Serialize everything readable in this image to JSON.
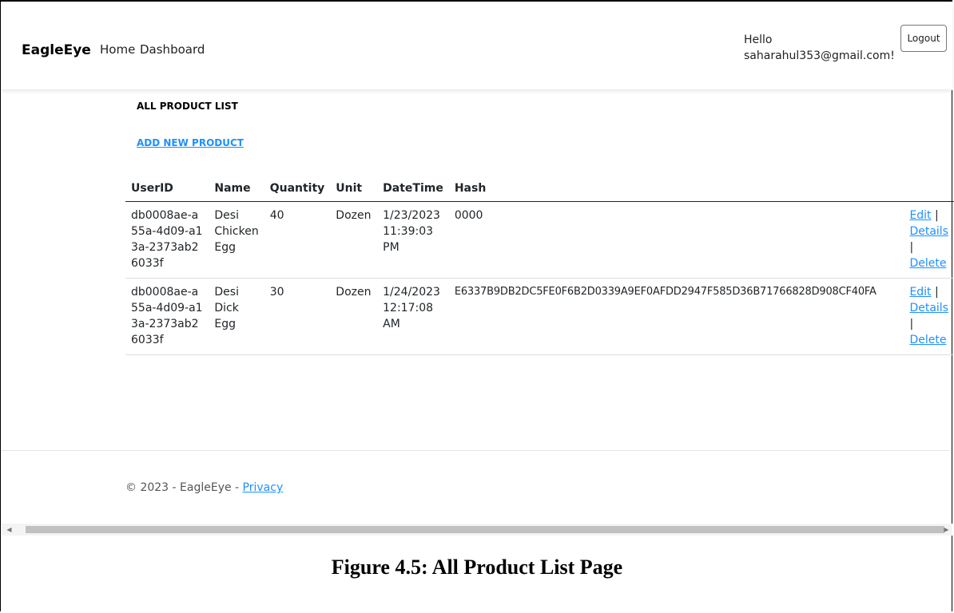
{
  "navbar": {
    "brand": "EagleEye",
    "links": [
      "Home",
      "Dashboard"
    ],
    "greeting_line1": "Hello",
    "greeting_line2": "saharahul353@gmail.com!",
    "logout_label": "Logout"
  },
  "main": {
    "title": "ALL PRODUCT LIST",
    "add_link": "ADD NEW PRODUCT",
    "columns": [
      "UserID",
      "Name",
      "Quantity",
      "Unit",
      "DateTime",
      "Hash"
    ],
    "rows": [
      {
        "userid": "db0008ae-a55a-4d09-a13a-2373ab26033f",
        "name": "Desi Chicken Egg",
        "quantity": "40",
        "unit": "Dozen",
        "datetime": "1/23/2023 11:39:03 PM",
        "hash": "0000",
        "edit": "Edit",
        "details": "Details",
        "delete": "Delete"
      },
      {
        "userid": "db0008ae-a55a-4d09-a13a-2373ab26033f",
        "name": "Desi Dick Egg",
        "quantity": "30",
        "unit": "Dozen",
        "datetime": "1/24/2023 12:17:08 AM",
        "hash": "E6337B9DB2DC5FE0F6B2D0339A9EF0AFDD2947F585D36B71766828D908CF40FA",
        "edit": "Edit",
        "details": "Details",
        "delete": "Delete"
      }
    ],
    "separator": "|"
  },
  "footer": {
    "text": "© 2023 - EagleEye - ",
    "privacy": "Privacy"
  },
  "caption": "Figure 4.5: All Product List Page",
  "colors": {
    "link": "#1e90ff",
    "text": "#212529"
  }
}
